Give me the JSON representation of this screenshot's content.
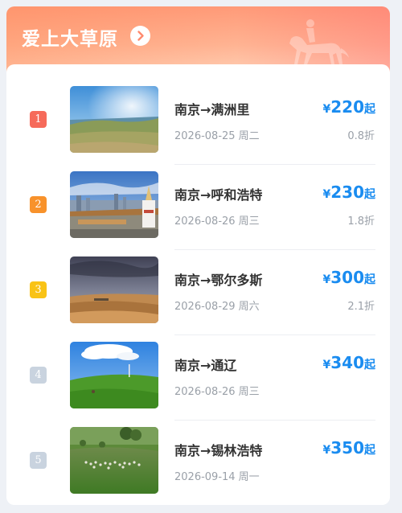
{
  "header": {
    "title": "爱上大草原",
    "arrow_icon": "chevron-right-icon",
    "decoration_icon": "horse-rider-icon"
  },
  "colors": {
    "rank_colors": [
      "#f66a5a",
      "#f8922b",
      "#f9c316",
      "#c9d3df",
      "#c9d3df"
    ],
    "price": "#1a8cf0",
    "header_gradient_start": "#ff9a78"
  },
  "routes": [
    {
      "rank": "1",
      "route": "南京→满洲里",
      "date": "2026-08-25 周二",
      "currency": "¥",
      "price": "220",
      "suffix": "起",
      "discount": "0.8折"
    },
    {
      "rank": "2",
      "route": "南京→呼和浩特",
      "date": "2026-08-26 周三",
      "currency": "¥",
      "price": "230",
      "suffix": "起",
      "discount": "1.8折"
    },
    {
      "rank": "3",
      "route": "南京→鄂尔多斯",
      "date": "2026-08-29 周六",
      "currency": "¥",
      "price": "300",
      "suffix": "起",
      "discount": "2.1折"
    },
    {
      "rank": "4",
      "route": "南京→通辽",
      "date": "2026-08-26 周三",
      "currency": "¥",
      "price": "340",
      "suffix": "起",
      "discount": ""
    },
    {
      "rank": "5",
      "route": "南京→锡林浩特",
      "date": "2026-09-14 周一",
      "currency": "¥",
      "price": "350",
      "suffix": "起",
      "discount": ""
    }
  ]
}
